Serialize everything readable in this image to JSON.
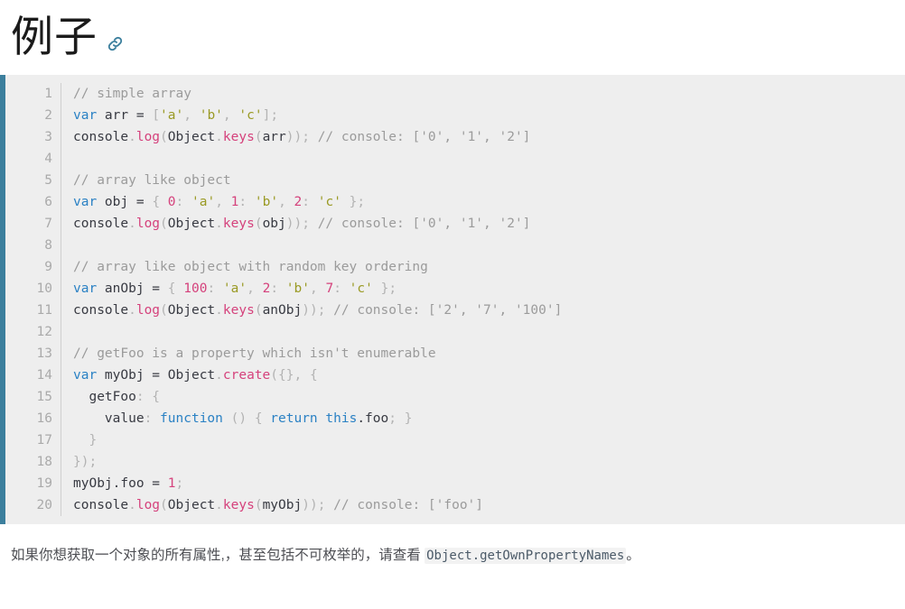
{
  "heading": {
    "text": "例子",
    "anchor_icon": "link-icon",
    "anchor_color": "#3c7f9d"
  },
  "code_block": {
    "language": "javascript",
    "background": "#eeeeee",
    "accent_border": "#3c7f9d",
    "gutter_color": "#aaaaaa",
    "line_count": 20,
    "line_numbers": [
      "1",
      "2",
      "3",
      "4",
      "5",
      "6",
      "7",
      "8",
      "9",
      "10",
      "11",
      "12",
      "13",
      "14",
      "15",
      "16",
      "17",
      "18",
      "19",
      "20"
    ],
    "lines": [
      [
        {
          "t": "// simple array",
          "c": "comment"
        }
      ],
      [
        {
          "t": "var",
          "c": "keyword"
        },
        {
          "t": " arr = ",
          "c": "plain"
        },
        {
          "t": "[",
          "c": "punct"
        },
        {
          "t": "'a'",
          "c": "string"
        },
        {
          "t": ", ",
          "c": "punct"
        },
        {
          "t": "'b'",
          "c": "string"
        },
        {
          "t": ", ",
          "c": "punct"
        },
        {
          "t": "'c'",
          "c": "string"
        },
        {
          "t": "]",
          "c": "punct"
        },
        {
          "t": ";",
          "c": "punct"
        }
      ],
      [
        {
          "t": "console",
          "c": "plain"
        },
        {
          "t": ".",
          "c": "punct"
        },
        {
          "t": "log",
          "c": "function"
        },
        {
          "t": "(",
          "c": "punct"
        },
        {
          "t": "Object",
          "c": "plain"
        },
        {
          "t": ".",
          "c": "punct"
        },
        {
          "t": "keys",
          "c": "function"
        },
        {
          "t": "(",
          "c": "punct"
        },
        {
          "t": "arr",
          "c": "plain"
        },
        {
          "t": "))",
          "c": "punct"
        },
        {
          "t": "; ",
          "c": "punct"
        },
        {
          "t": "// console: ['0', '1', '2']",
          "c": "comment"
        }
      ],
      [
        {
          "t": "",
          "c": "plain"
        }
      ],
      [
        {
          "t": "// array like object",
          "c": "comment"
        }
      ],
      [
        {
          "t": "var",
          "c": "keyword"
        },
        {
          "t": " obj = ",
          "c": "plain"
        },
        {
          "t": "{ ",
          "c": "punct"
        },
        {
          "t": "0",
          "c": "number"
        },
        {
          "t": ": ",
          "c": "punct"
        },
        {
          "t": "'a'",
          "c": "string"
        },
        {
          "t": ", ",
          "c": "punct"
        },
        {
          "t": "1",
          "c": "number"
        },
        {
          "t": ": ",
          "c": "punct"
        },
        {
          "t": "'b'",
          "c": "string"
        },
        {
          "t": ", ",
          "c": "punct"
        },
        {
          "t": "2",
          "c": "number"
        },
        {
          "t": ": ",
          "c": "punct"
        },
        {
          "t": "'c'",
          "c": "string"
        },
        {
          "t": " }",
          "c": "punct"
        },
        {
          "t": ";",
          "c": "punct"
        }
      ],
      [
        {
          "t": "console",
          "c": "plain"
        },
        {
          "t": ".",
          "c": "punct"
        },
        {
          "t": "log",
          "c": "function"
        },
        {
          "t": "(",
          "c": "punct"
        },
        {
          "t": "Object",
          "c": "plain"
        },
        {
          "t": ".",
          "c": "punct"
        },
        {
          "t": "keys",
          "c": "function"
        },
        {
          "t": "(",
          "c": "punct"
        },
        {
          "t": "obj",
          "c": "plain"
        },
        {
          "t": "))",
          "c": "punct"
        },
        {
          "t": "; ",
          "c": "punct"
        },
        {
          "t": "// console: ['0', '1', '2']",
          "c": "comment"
        }
      ],
      [
        {
          "t": "",
          "c": "plain"
        }
      ],
      [
        {
          "t": "// array like object with random key ordering",
          "c": "comment"
        }
      ],
      [
        {
          "t": "var",
          "c": "keyword"
        },
        {
          "t": " anObj = ",
          "c": "plain"
        },
        {
          "t": "{ ",
          "c": "punct"
        },
        {
          "t": "100",
          "c": "number"
        },
        {
          "t": ": ",
          "c": "punct"
        },
        {
          "t": "'a'",
          "c": "string"
        },
        {
          "t": ", ",
          "c": "punct"
        },
        {
          "t": "2",
          "c": "number"
        },
        {
          "t": ": ",
          "c": "punct"
        },
        {
          "t": "'b'",
          "c": "string"
        },
        {
          "t": ", ",
          "c": "punct"
        },
        {
          "t": "7",
          "c": "number"
        },
        {
          "t": ": ",
          "c": "punct"
        },
        {
          "t": "'c'",
          "c": "string"
        },
        {
          "t": " }",
          "c": "punct"
        },
        {
          "t": ";",
          "c": "punct"
        }
      ],
      [
        {
          "t": "console",
          "c": "plain"
        },
        {
          "t": ".",
          "c": "punct"
        },
        {
          "t": "log",
          "c": "function"
        },
        {
          "t": "(",
          "c": "punct"
        },
        {
          "t": "Object",
          "c": "plain"
        },
        {
          "t": ".",
          "c": "punct"
        },
        {
          "t": "keys",
          "c": "function"
        },
        {
          "t": "(",
          "c": "punct"
        },
        {
          "t": "anObj",
          "c": "plain"
        },
        {
          "t": "))",
          "c": "punct"
        },
        {
          "t": "; ",
          "c": "punct"
        },
        {
          "t": "// console: ['2', '7', '100']",
          "c": "comment"
        }
      ],
      [
        {
          "t": "",
          "c": "plain"
        }
      ],
      [
        {
          "t": "// getFoo is a property which isn't enumerable",
          "c": "comment"
        }
      ],
      [
        {
          "t": "var",
          "c": "keyword"
        },
        {
          "t": " myObj = ",
          "c": "plain"
        },
        {
          "t": "Object",
          "c": "plain"
        },
        {
          "t": ".",
          "c": "punct"
        },
        {
          "t": "create",
          "c": "function"
        },
        {
          "t": "({}, {",
          "c": "punct"
        }
      ],
      [
        {
          "t": "  getFoo",
          "c": "plain"
        },
        {
          "t": ": {",
          "c": "punct"
        }
      ],
      [
        {
          "t": "    value",
          "c": "plain"
        },
        {
          "t": ": ",
          "c": "punct"
        },
        {
          "t": "function",
          "c": "keyword"
        },
        {
          "t": " ",
          "c": "plain"
        },
        {
          "t": "() {",
          "c": "punct"
        },
        {
          "t": " ",
          "c": "plain"
        },
        {
          "t": "return",
          "c": "keyword"
        },
        {
          "t": " ",
          "c": "plain"
        },
        {
          "t": "this",
          "c": "keyword"
        },
        {
          "t": ".foo",
          "c": "plain"
        },
        {
          "t": "; }",
          "c": "punct"
        }
      ],
      [
        {
          "t": "  }",
          "c": "punct"
        }
      ],
      [
        {
          "t": "})",
          "c": "punct"
        },
        {
          "t": ";",
          "c": "punct"
        }
      ],
      [
        {
          "t": "myObj.foo = ",
          "c": "plain"
        },
        {
          "t": "1",
          "c": "number"
        },
        {
          "t": ";",
          "c": "punct"
        }
      ],
      [
        {
          "t": "console",
          "c": "plain"
        },
        {
          "t": ".",
          "c": "punct"
        },
        {
          "t": "log",
          "c": "function"
        },
        {
          "t": "(",
          "c": "punct"
        },
        {
          "t": "Object",
          "c": "plain"
        },
        {
          "t": ".",
          "c": "punct"
        },
        {
          "t": "keys",
          "c": "function"
        },
        {
          "t": "(",
          "c": "punct"
        },
        {
          "t": "myObj",
          "c": "plain"
        },
        {
          "t": "))",
          "c": "punct"
        },
        {
          "t": "; ",
          "c": "punct"
        },
        {
          "t": "// console: ['foo']",
          "c": "comment"
        }
      ]
    ]
  },
  "paragraph": {
    "before_code": "如果你想获取一个对象的所有属性,，甚至包括不可枚举的，请查看 ",
    "code": "Object.getOwnPropertyNames",
    "after_code": "。"
  }
}
